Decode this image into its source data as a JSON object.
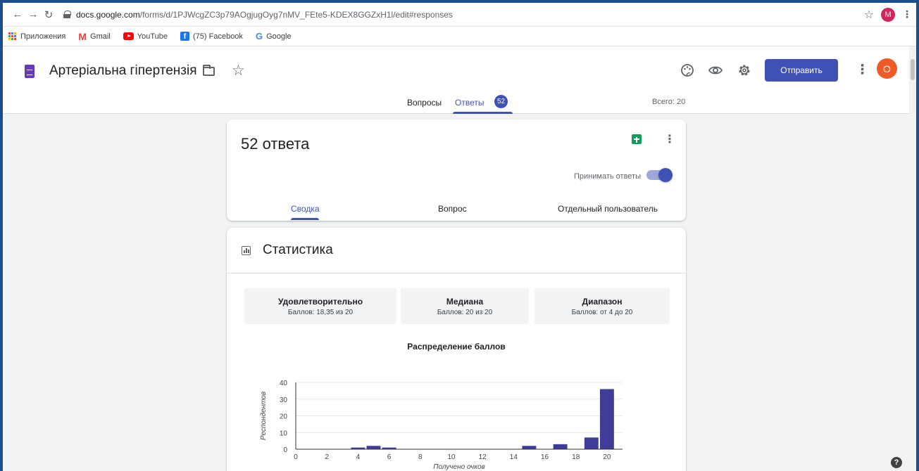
{
  "browser": {
    "url_host": "docs.google.com",
    "url_path": "/forms/d/1PJWcgZC3p79AOgjugOyg7nMV_FEte5-KDEX8GGZxH1l/edit#responses",
    "profile_initial": "M"
  },
  "bookmarks": {
    "apps": "Приложения",
    "gmail": "Gmail",
    "youtube": "YouTube",
    "facebook": "(75) Facebook",
    "google": "Google"
  },
  "header": {
    "title": "Артеріальна гіпертензія",
    "send_label": "Отправить",
    "avatar_initial": "О"
  },
  "tabs": {
    "questions": "Вопросы",
    "answers": "Ответы",
    "answers_badge": "52",
    "total": "Всего: 20"
  },
  "summary": {
    "count": "52 ответа",
    "accept_label": "Принимать ответы",
    "accepting": true,
    "subtabs": [
      "Сводка",
      "Вопрос",
      "Отдельный пользователь"
    ]
  },
  "stats": {
    "title": "Статистика",
    "metrics": [
      {
        "title": "Удовлетворительно",
        "value": "Баллов: 18,35 из 20"
      },
      {
        "title": "Медиана",
        "value": "Баллов: 20 из 20"
      },
      {
        "title": "Диапазон",
        "value": "Баллов: от 4 до 20"
      }
    ],
    "chart_title": "Распределение баллов"
  },
  "chart_data": {
    "type": "bar",
    "title": "Распределение баллов",
    "xlabel": "Получено очков",
    "ylabel": "Респондентов",
    "x": [
      4,
      5,
      6,
      15,
      17,
      19,
      20
    ],
    "values": [
      1,
      2,
      1,
      2,
      3,
      7,
      36
    ],
    "xlim": [
      0,
      21
    ],
    "ylim": [
      0,
      40
    ],
    "xticks": [
      0,
      2,
      4,
      6,
      8,
      10,
      12,
      14,
      16,
      18,
      20
    ],
    "yticks": [
      0,
      10,
      20,
      30,
      40
    ],
    "bar_color": "#3f3d99",
    "grid": true
  },
  "colors": {
    "accent": "#3f51b5"
  }
}
